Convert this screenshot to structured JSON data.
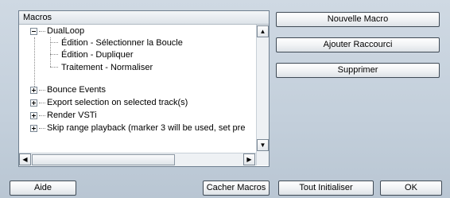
{
  "tree": {
    "header": "Macros",
    "items": [
      {
        "label": "DualLoop",
        "expanded": true,
        "children": [
          {
            "label": "Édition - Sélectionner la Boucle"
          },
          {
            "label": "Édition - Dupliquer"
          },
          {
            "label": "Traitement - Normaliser"
          }
        ]
      },
      {
        "label": "Bounce Events",
        "expanded": false
      },
      {
        "label": "Export selection on selected track(s)",
        "expanded": false
      },
      {
        "label": "Render VSTi",
        "expanded": false
      },
      {
        "label": "Skip range playback (marker 3 will be used, set pre",
        "expanded": false
      }
    ]
  },
  "scroll": {
    "up": "▲",
    "down": "▼",
    "left": "◀",
    "right": "▶"
  },
  "side_buttons": {
    "new_macro": "Nouvelle Macro",
    "add_shortcut": "Ajouter Raccourci",
    "delete": "Supprimer"
  },
  "bottom_buttons": {
    "help": "Aide",
    "hide_macros": "Cacher Macros",
    "reset_all": "Tout Initialiser",
    "ok": "OK"
  }
}
